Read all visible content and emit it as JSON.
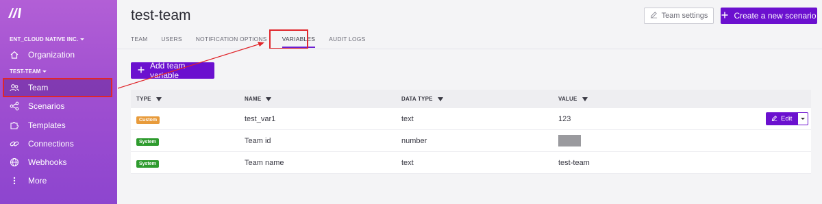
{
  "sidebar": {
    "org_name": "ENT_CLOUD NATIVE INC.",
    "team_name": "TEST-TEAM",
    "items": [
      {
        "label": "Organization",
        "icon": "home-icon"
      },
      {
        "label": "Team",
        "icon": "users-icon",
        "active": true
      },
      {
        "label": "Scenarios",
        "icon": "share-nodes-icon"
      },
      {
        "label": "Templates",
        "icon": "puzzle-icon"
      },
      {
        "label": "Connections",
        "icon": "link-icon"
      },
      {
        "label": "Webhooks",
        "icon": "globe-icon"
      },
      {
        "label": "More",
        "icon": "more-vertical-icon"
      }
    ]
  },
  "header": {
    "title": "test-team",
    "settings_label": "Team settings",
    "create_label": "Create a new scenario"
  },
  "tabs": [
    {
      "label": "TEAM"
    },
    {
      "label": "USERS"
    },
    {
      "label": "NOTIFICATION OPTIONS"
    },
    {
      "label": "VARIABLES",
      "active": true
    },
    {
      "label": "AUDIT LOGS"
    }
  ],
  "add_variable_label": "Add team variable",
  "table": {
    "columns": [
      "TYPE",
      "NAME",
      "DATA TYPE",
      "VALUE"
    ],
    "rows": [
      {
        "type": "Custom",
        "name": "test_var1",
        "data_type": "text",
        "value": "123",
        "editable": true
      },
      {
        "type": "System",
        "name": "Team id",
        "data_type": "number",
        "value": "",
        "redacted": true
      },
      {
        "type": "System",
        "name": "Team name",
        "data_type": "text",
        "value": "test-team"
      }
    ],
    "edit_label": "Edit"
  },
  "colors": {
    "accent": "#6b10cf",
    "sidebar_top": "#b25fd6",
    "annotation": "#e0262b",
    "badge_custom": "#e89b3b",
    "badge_system": "#2e9b2e"
  }
}
